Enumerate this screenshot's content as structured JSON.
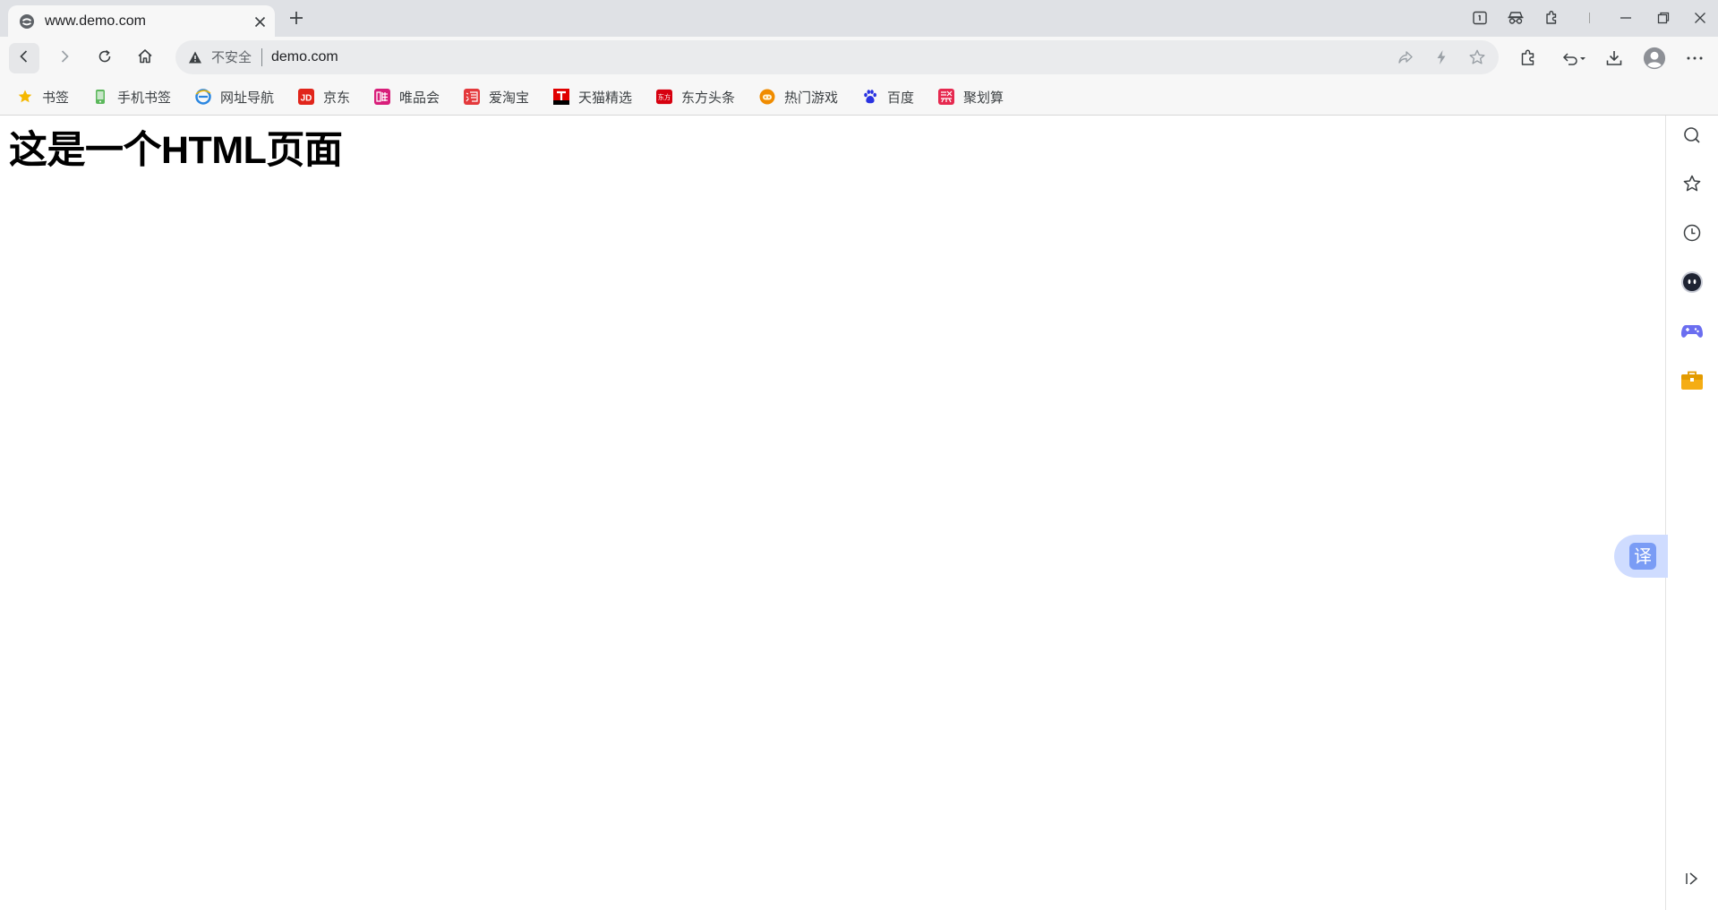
{
  "tab": {
    "title": "www.demo.com",
    "favicon": "browser-e-icon",
    "close_glyph": "✕",
    "new_tab_glyph": "+"
  },
  "window_controls": [
    "reading-mode-icon",
    "incognito-icon",
    "extensions-puzzle-icon",
    "minimize-icon",
    "restore-icon",
    "close-window-icon"
  ],
  "toolbar": {
    "security_label": "不安全",
    "url": "demo.com",
    "icons": [
      "back-icon",
      "forward-icon",
      "reload-icon",
      "home-icon",
      "share-icon",
      "lightning-icon",
      "star-icon",
      "extensions-icon",
      "undo-icon",
      "download-icon",
      "profile-avatar-icon",
      "more-icon"
    ]
  },
  "bookmarks": [
    {
      "label": "书签",
      "icon": "star-icon",
      "color": "#f5b800"
    },
    {
      "label": "手机书签",
      "icon": "phone-bookmark-icon",
      "color": "#4caf50"
    },
    {
      "label": "网址导航",
      "icon": "ie-nav-icon",
      "color": "#2a86e0"
    },
    {
      "label": "京东",
      "icon": "jd-icon",
      "color": "#e1251b"
    },
    {
      "label": "唯品会",
      "icon": "vip-icon",
      "color": "#d81e7a"
    },
    {
      "label": "爱淘宝",
      "icon": "taobao-icon",
      "color": "#e4393c"
    },
    {
      "label": "天猫精选",
      "icon": "tmall-icon",
      "color": "#e00000"
    },
    {
      "label": "东方头条",
      "icon": "dongfang-icon",
      "color": "#d7000f"
    },
    {
      "label": "热门游戏",
      "icon": "game-hot-icon",
      "color": "#f08c00"
    },
    {
      "label": "百度",
      "icon": "baidu-paw-icon",
      "color": "#2932e1"
    },
    {
      "label": "聚划算",
      "icon": "juhuasuan-icon",
      "color": "#e6294f"
    }
  ],
  "page": {
    "heading": "这是一个HTML页面"
  },
  "sidebar": {
    "icons": [
      "search-icon",
      "favorites-star-icon",
      "history-clock-icon",
      "ai-bot-icon",
      "gamepad-icon",
      "toolbox-icon",
      "collapse-sidebar-icon"
    ]
  },
  "translate": {
    "label": "译"
  }
}
